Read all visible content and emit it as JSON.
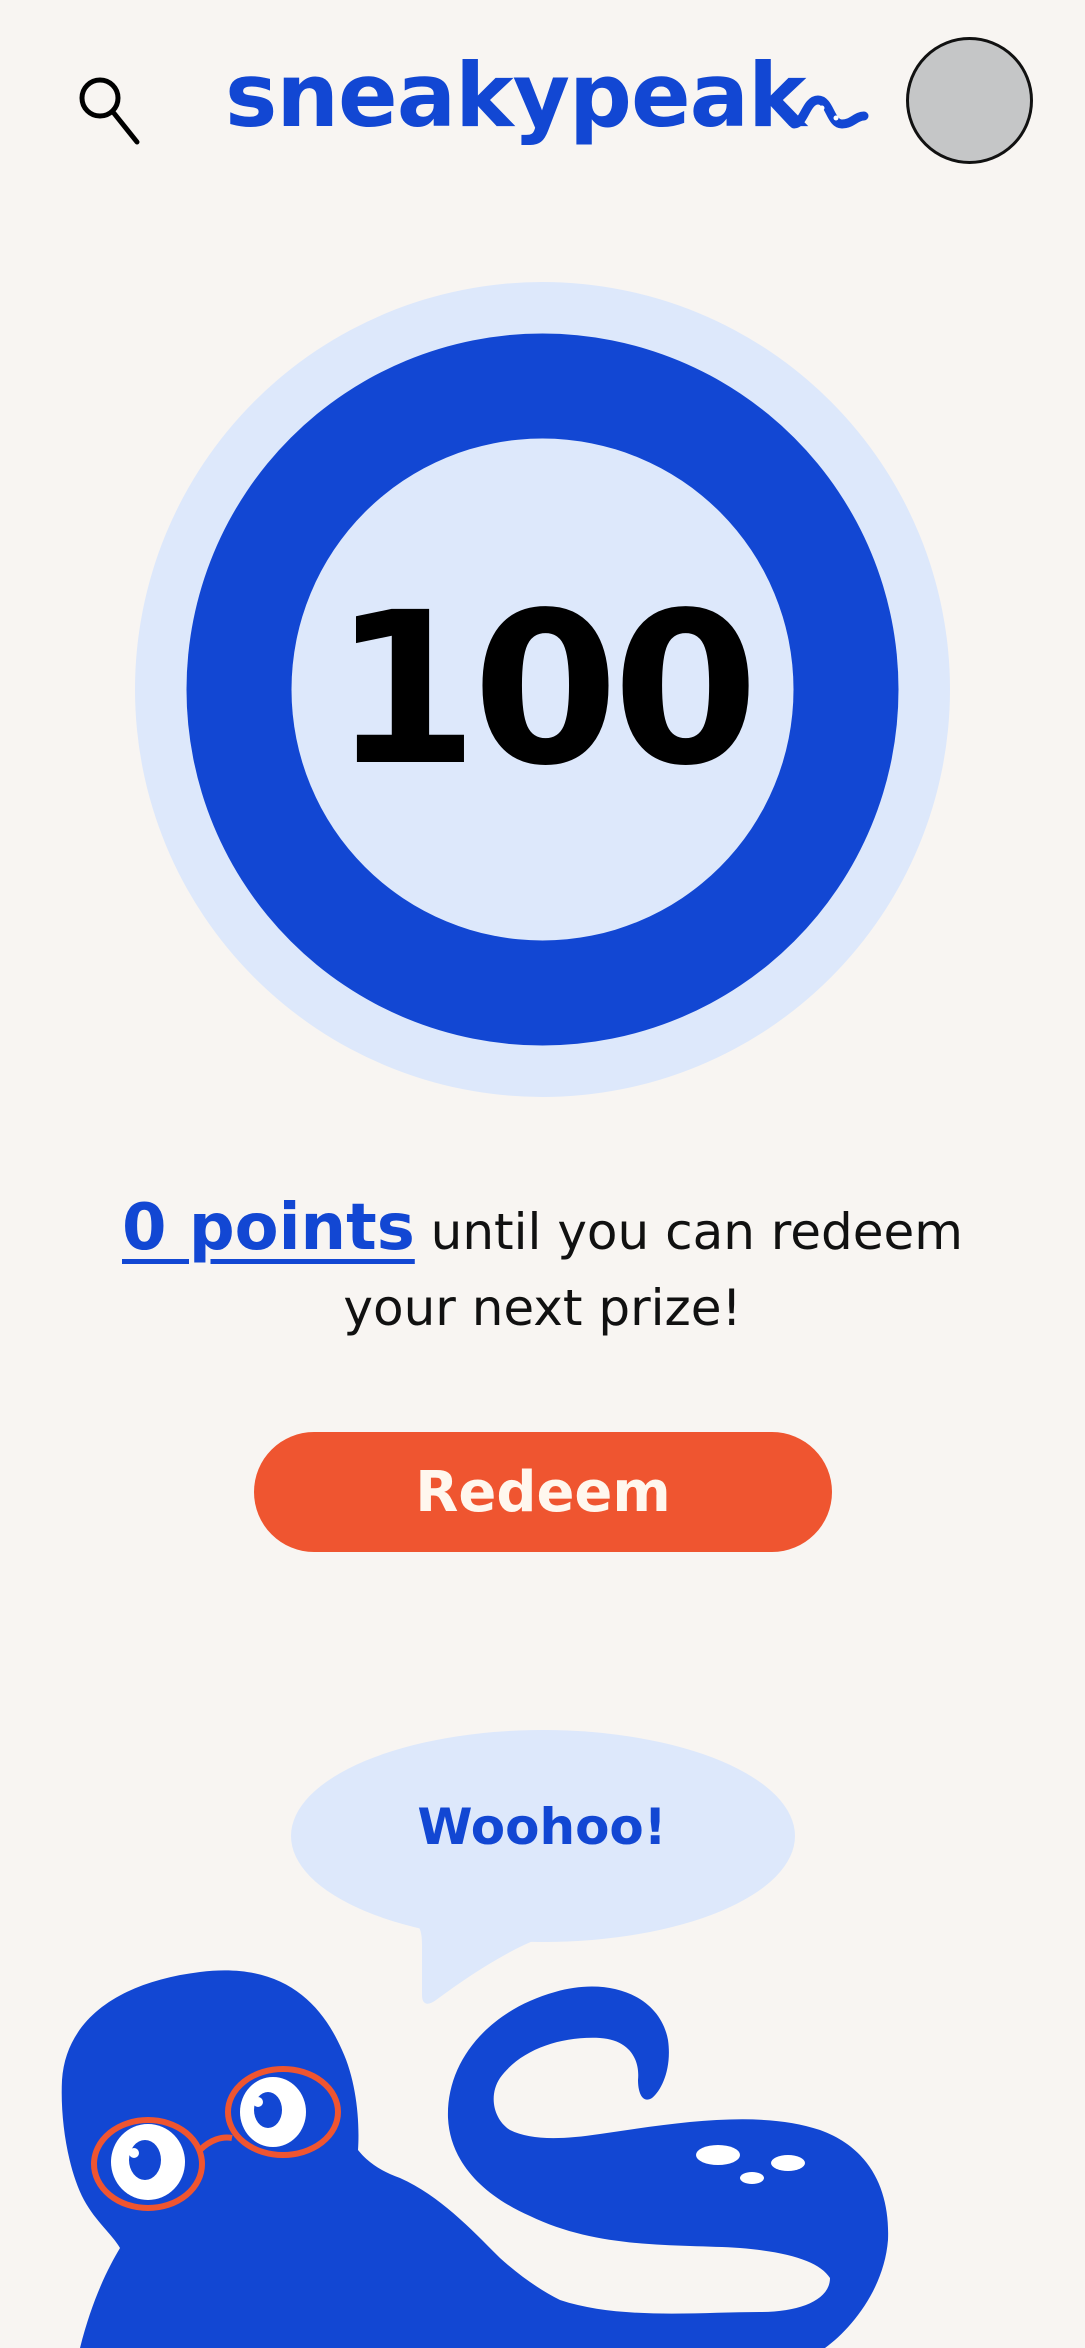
{
  "header": {
    "search_icon": "search-icon",
    "logo_text": "sneakypeak",
    "avatar_icon": "avatar"
  },
  "points": {
    "value": "100",
    "ring_color": "#1247d3",
    "ring_light_color": "#dde8fb"
  },
  "message": {
    "points_link": "0 points",
    "text": " until you can redeem your next prize!"
  },
  "redeem": {
    "label": "Redeem",
    "color": "#ef5530"
  },
  "mascot": {
    "speech": "Woohoo!",
    "body_color": "#1247d3",
    "glasses_color": "#ef5530"
  }
}
